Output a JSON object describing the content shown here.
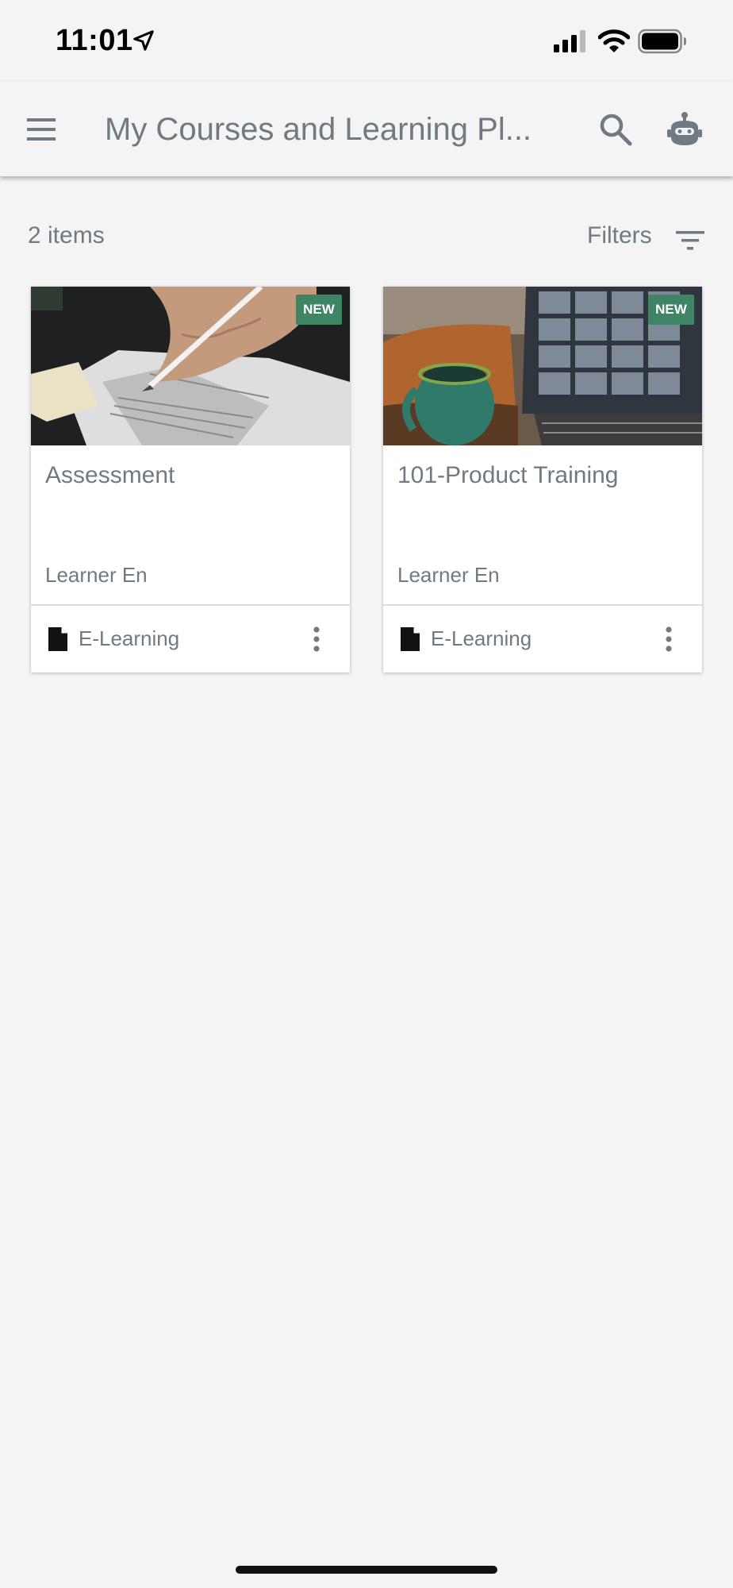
{
  "status_bar": {
    "time": "11:01",
    "icons": [
      "location-arrow-icon",
      "cellular-signal-icon",
      "wifi-icon",
      "battery-icon"
    ]
  },
  "header": {
    "title": "My Courses and Learning Pl...",
    "icons": [
      "menu-icon",
      "search-icon",
      "bot-icon"
    ]
  },
  "toolbar": {
    "items_count": "2 items",
    "filters_label": "Filters"
  },
  "cards": [
    {
      "badge": "NEW",
      "title": "Assessment",
      "author": "Learner En",
      "type": "E-Learning",
      "type_icon": "document-icon"
    },
    {
      "badge": "NEW",
      "title": "101-Product Training",
      "author": "Learner En",
      "type": "E-Learning",
      "type_icon": "document-icon"
    }
  ],
  "colors": {
    "background": "#f4f4f4",
    "text": "#6f7a82",
    "badge": "#3f8464"
  }
}
